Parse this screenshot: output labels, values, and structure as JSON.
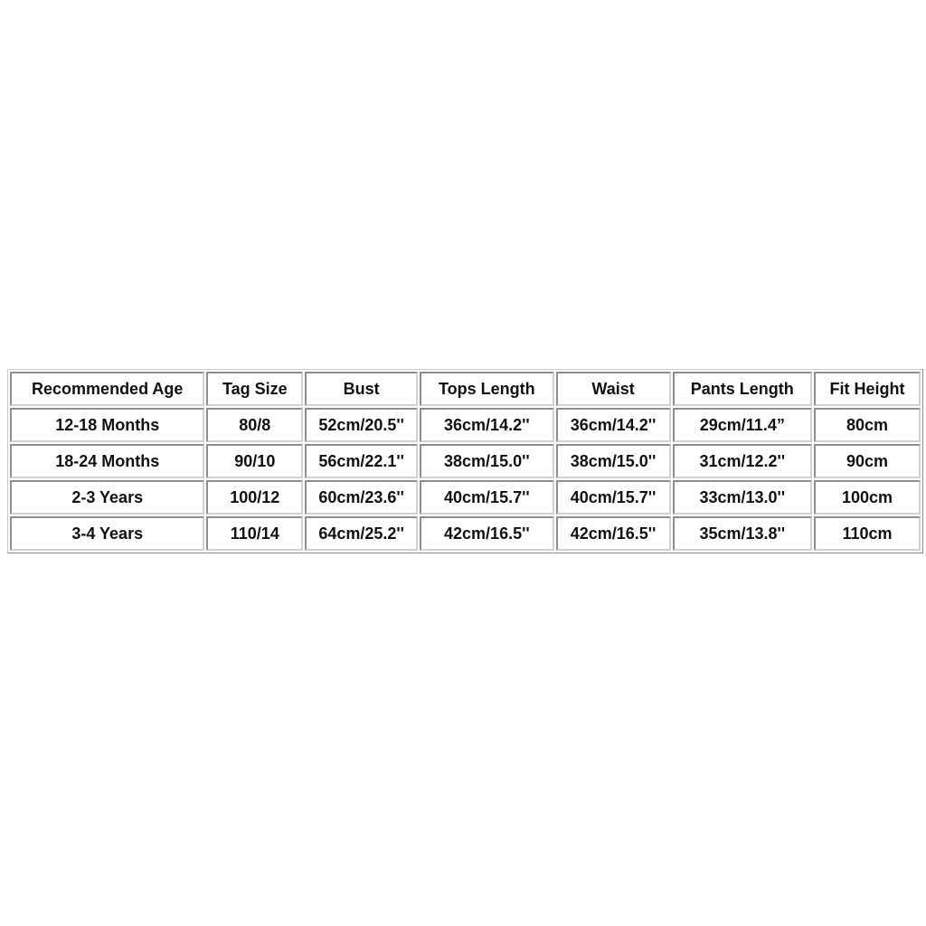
{
  "table": {
    "headers": [
      "Recommended Age",
      "Tag Size",
      "Bust",
      "Tops Length",
      "Waist",
      "Pants Length",
      "Fit Height"
    ],
    "rows": [
      [
        "12-18 Months",
        "80/8",
        "52cm/20.5''",
        "36cm/14.2''",
        "36cm/14.2''",
        "29cm/11.4”",
        "80cm"
      ],
      [
        "18-24 Months",
        "90/10",
        "56cm/22.1''",
        "38cm/15.0''",
        "38cm/15.0''",
        "31cm/12.2''",
        "90cm"
      ],
      [
        "2-3 Years",
        "100/12",
        "60cm/23.6''",
        "40cm/15.7''",
        "40cm/15.7''",
        "33cm/13.0''",
        "100cm"
      ],
      [
        "3-4 Years",
        "110/14",
        "64cm/25.2''",
        "42cm/16.5''",
        "42cm/16.5''",
        "35cm/13.8''",
        "110cm"
      ]
    ]
  }
}
